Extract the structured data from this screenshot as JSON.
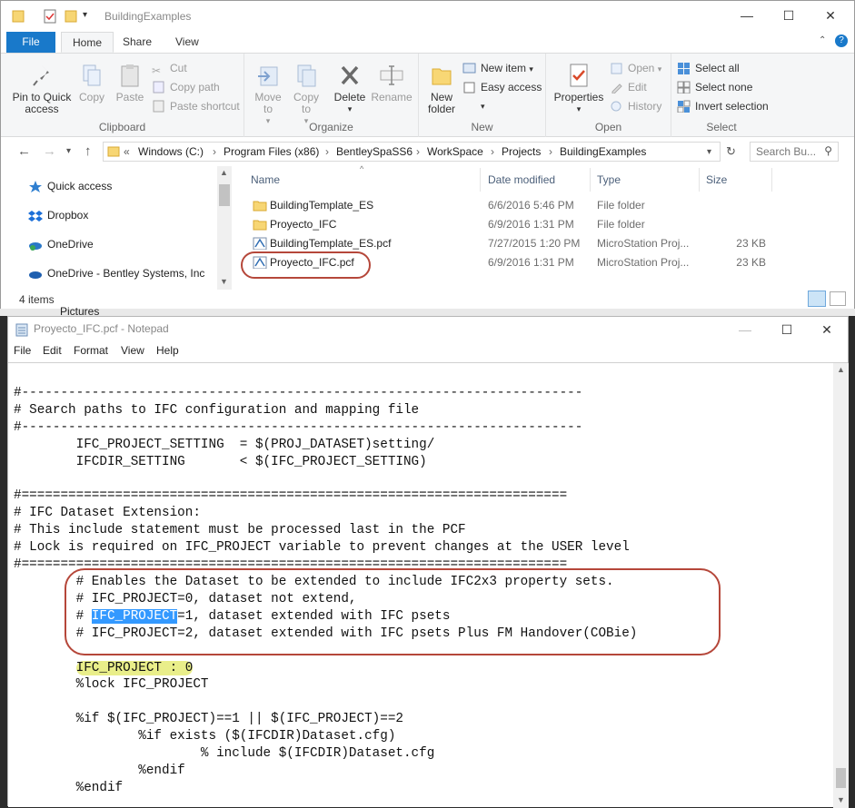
{
  "explorer": {
    "title": "BuildingExamples",
    "window_buttons": {
      "minimize": "—",
      "maximize": "☐",
      "close": "✕"
    },
    "tabs": [
      {
        "label": "File"
      },
      {
        "label": "Home"
      },
      {
        "label": "Share"
      },
      {
        "label": "View"
      }
    ],
    "ribbon": {
      "clipboard": {
        "label": "Clipboard",
        "pin": "Pin to Quick access",
        "copy": "Copy",
        "paste": "Paste",
        "cut": "Cut",
        "copy_path": "Copy path",
        "paste_shortcut": "Paste shortcut"
      },
      "organize": {
        "label": "Organize",
        "move_to": "Move to",
        "copy_to": "Copy to",
        "delete": "Delete",
        "rename": "Rename"
      },
      "new": {
        "label": "New",
        "new_folder": "New folder",
        "new_item": "New item",
        "easy_access": "Easy access"
      },
      "open": {
        "label": "Open",
        "properties": "Properties",
        "open": "Open",
        "edit": "Edit",
        "history": "History"
      },
      "select": {
        "label": "Select",
        "select_all": "Select all",
        "select_none": "Select none",
        "invert": "Invert selection"
      }
    },
    "address": {
      "breadcrumbs": [
        "Windows (C:)",
        "Program Files (x86)",
        "BentleySpaSS6",
        "WorkSpace",
        "Projects",
        "BuildingExamples"
      ],
      "search_placeholder": "Search Bu..."
    },
    "nav": [
      {
        "label": "Quick access"
      },
      {
        "label": "Dropbox"
      },
      {
        "label": "OneDrive"
      },
      {
        "label": "OneDrive - Bentley Systems, Inc"
      }
    ],
    "columns": {
      "name": "Name",
      "date": "Date modified",
      "type": "Type",
      "size": "Size"
    },
    "files": [
      {
        "name": "BuildingTemplate_ES",
        "date": "6/6/2016 5:46 PM",
        "type": "File folder",
        "size": ""
      },
      {
        "name": "Proyecto_IFC",
        "date": "6/9/2016 1:31 PM",
        "type": "File folder",
        "size": ""
      },
      {
        "name": "BuildingTemplate_ES.pcf",
        "date": "7/27/2015 1:20 PM",
        "type": "MicroStation Proj...",
        "size": "23 KB"
      },
      {
        "name": "Proyecto_IFC.pcf",
        "date": "6/9/2016 1:31 PM",
        "type": "MicroStation Proj...",
        "size": "23 KB"
      }
    ],
    "status": "4 items",
    "behind_label": "Pictures"
  },
  "notepad": {
    "title": "Proyecto_IFC.pcf - Notepad",
    "menu": [
      {
        "label": "File"
      },
      {
        "label": "Edit"
      },
      {
        "label": "Format"
      },
      {
        "label": "View"
      },
      {
        "label": "Help"
      }
    ],
    "lines": {
      "l1": "#------------------------------------------------------------------------",
      "l2": "# Search paths to IFC configuration and mapping file",
      "l3": "#------------------------------------------------------------------------",
      "l4": "        IFC_PROJECT_SETTING  = $(PROJ_DATASET)setting/",
      "l5": "        IFCDIR_SETTING       < $(IFC_PROJECT_SETTING)",
      "l6": "",
      "l7": "#======================================================================",
      "l8": "# IFC Dataset Extension:",
      "l9": "# This include statement must be processed last in the PCF",
      "l10": "# Lock is required on IFC_PROJECT variable to prevent changes at the USER level",
      "l11": "#======================================================================",
      "l12": "        # Enables the Dataset to be extended to include IFC2x3 property sets.",
      "l13": "        # IFC_PROJECT=0, dataset not extend,",
      "l14_pre": "        # ",
      "l14_sel": "IFC_PROJECT",
      "l14_post": "=1, dataset extended with IFC psets",
      "l15": "        # IFC_PROJECT=2, dataset extended with IFC psets Plus FM Handover(COBie)",
      "l16": "",
      "l17_pre": "        ",
      "l17_hl": "IFC_PROJECT : 0",
      "l18": "        %lock IFC_PROJECT",
      "l19": "",
      "l20": "        %if $(IFC_PROJECT)==1 || $(IFC_PROJECT)==2",
      "l21": "                %if exists ($(IFCDIR)Dataset.cfg)",
      "l22": "                        % include $(IFCDIR)Dataset.cfg",
      "l23": "                %endif",
      "l24": "        %endif"
    }
  }
}
